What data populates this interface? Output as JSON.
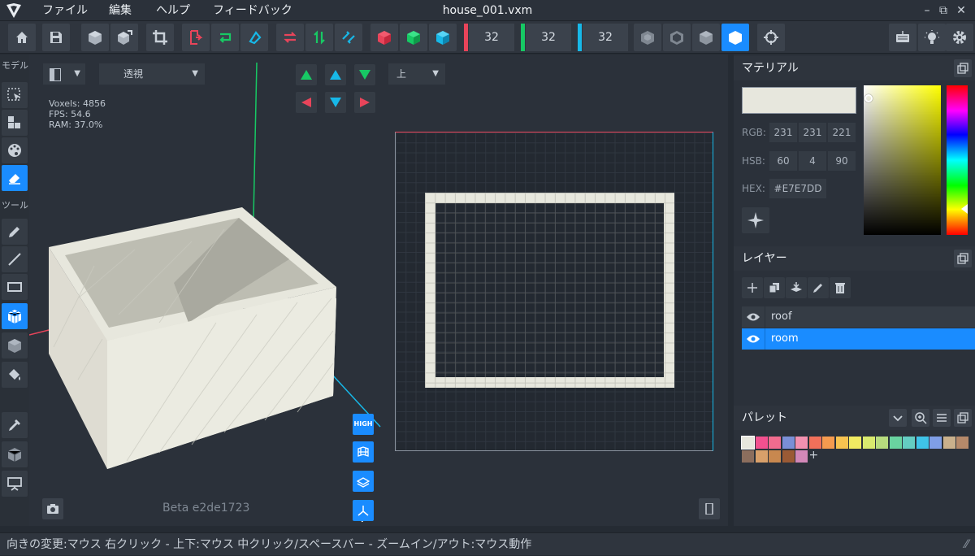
{
  "menubar": {
    "items": [
      "ファイル",
      "編集",
      "ヘルプ",
      "フィードバック"
    ],
    "title": "house_001.vxm"
  },
  "window_controls": {
    "minimize": "–",
    "restore": "⧉",
    "close": "✕"
  },
  "toolbar": {
    "dim_x": "32",
    "dim_y": "32",
    "dim_z": "32",
    "dim_colors": [
      "#e8445a",
      "#17c964",
      "#17b8e8"
    ]
  },
  "left_toolbar": {
    "section_model": "モデル",
    "section_tools": "ツール"
  },
  "viewport": {
    "view_mode": "透視",
    "plane_select": "上",
    "stats": {
      "voxels": "Voxels: 4856",
      "fps": "FPS: 54.6",
      "ram": "RAM: 37.0%"
    },
    "high_label": "HIGH",
    "version": "Beta e2de1723"
  },
  "material": {
    "title": "マテリアル",
    "rgb_label": "RGB:",
    "rgb": [
      "231",
      "231",
      "221"
    ],
    "hsb_label": "HSB:",
    "hsb": [
      "60",
      "4",
      "90"
    ],
    "hex_label": "HEX:",
    "hex": "#E7E7DD",
    "current_color": "#e7e7dd"
  },
  "layers": {
    "title": "レイヤー",
    "items": [
      {
        "name": "roof",
        "active": false
      },
      {
        "name": "room",
        "active": true
      }
    ]
  },
  "palette": {
    "title": "パレット",
    "add_label": "+",
    "row1": [
      "#e7e7dd",
      "#f2508f",
      "#f06b8e",
      "#7a8fd6",
      "#f291b0",
      "#f0705a",
      "#f49a4f",
      "#f7c350",
      "#f0ea62",
      "#d9ea6e",
      "#b7dc7e",
      "#69d3a0",
      "#64cdc2",
      "#3fc3e8",
      "#7f9ee6",
      "#c9b08c",
      "#b5896a"
    ],
    "row2": [
      "#8c6e5d",
      "#d9a06a",
      "#c8884f",
      "#9a5a35",
      "#d288b8"
    ]
  },
  "statusbar": {
    "text": "向きの変更:マウス 右クリック - 上下:マウス 中クリック/スペースバー - ズームイン/アウト:マウス動作"
  }
}
